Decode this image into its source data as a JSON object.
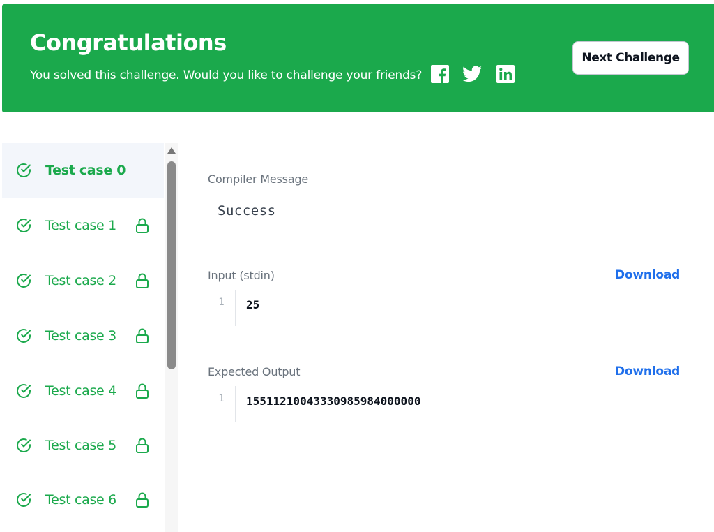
{
  "banner": {
    "title": "Congratulations",
    "subtitle": "You solved this challenge. Would you like to challenge your friends?",
    "social_icons": [
      "facebook-icon",
      "twitter-icon",
      "linkedin-icon"
    ],
    "next_button": "Next Challenge",
    "color": "#1ba94c"
  },
  "test_cases": [
    {
      "label": "Test case 0",
      "passed": true,
      "locked": false,
      "active": true
    },
    {
      "label": "Test case 1",
      "passed": true,
      "locked": true,
      "active": false
    },
    {
      "label": "Test case 2",
      "passed": true,
      "locked": true,
      "active": false
    },
    {
      "label": "Test case 3",
      "passed": true,
      "locked": true,
      "active": false
    },
    {
      "label": "Test case 4",
      "passed": true,
      "locked": true,
      "active": false
    },
    {
      "label": "Test case 5",
      "passed": true,
      "locked": true,
      "active": false
    },
    {
      "label": "Test case 6",
      "passed": true,
      "locked": true,
      "active": false
    }
  ],
  "result": {
    "compiler_label": "Compiler Message",
    "compiler_message": "Success",
    "input_label": "Input (stdin)",
    "input_download": "Download",
    "input_lines": [
      {
        "num": "1",
        "text": "25"
      }
    ],
    "output_label": "Expected Output",
    "output_download": "Download",
    "output_lines": [
      {
        "num": "1",
        "text": "15511210043330985984000000"
      }
    ]
  },
  "colors": {
    "success": "#1ba94c",
    "link": "#1f6feb"
  }
}
